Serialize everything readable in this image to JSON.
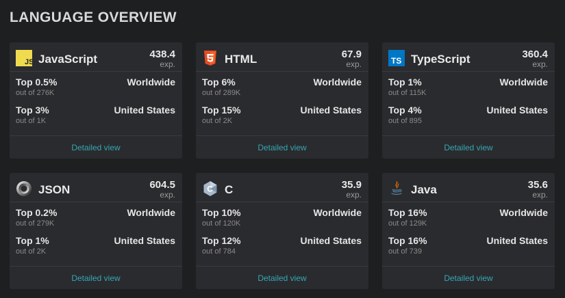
{
  "page": {
    "title": "LANGUAGE OVERVIEW"
  },
  "cards": [
    {
      "icon": "javascript-icon",
      "name": "JavaScript",
      "exp": "438.4",
      "exp_unit": "exp.",
      "worldwide": {
        "top": "Top 0.5%",
        "out_of": "out of 276K",
        "region": "Worldwide"
      },
      "us": {
        "top": "Top 3%",
        "out_of": "out of 1K",
        "region": "United States"
      },
      "link": "Detailed view"
    },
    {
      "icon": "html5-icon",
      "name": "HTML",
      "exp": "67.9",
      "exp_unit": "exp.",
      "worldwide": {
        "top": "Top 6%",
        "out_of": "out of 289K",
        "region": "Worldwide"
      },
      "us": {
        "top": "Top 15%",
        "out_of": "out of 2K",
        "region": "United States"
      },
      "link": "Detailed view"
    },
    {
      "icon": "typescript-icon",
      "name": "TypeScript",
      "exp": "360.4",
      "exp_unit": "exp.",
      "worldwide": {
        "top": "Top 1%",
        "out_of": "out of 115K",
        "region": "Worldwide"
      },
      "us": {
        "top": "Top 4%",
        "out_of": "out of 895",
        "region": "United States"
      },
      "link": "Detailed view"
    },
    {
      "icon": "json-icon",
      "name": "JSON",
      "exp": "604.5",
      "exp_unit": "exp.",
      "worldwide": {
        "top": "Top 0.2%",
        "out_of": "out of 279K",
        "region": "Worldwide"
      },
      "us": {
        "top": "Top 1%",
        "out_of": "out of 2K",
        "region": "United States"
      },
      "link": "Detailed view"
    },
    {
      "icon": "c-language-icon",
      "name": "C",
      "exp": "35.9",
      "exp_unit": "exp.",
      "worldwide": {
        "top": "Top 10%",
        "out_of": "out of 120K",
        "region": "Worldwide"
      },
      "us": {
        "top": "Top 12%",
        "out_of": "out of 784",
        "region": "United States"
      },
      "link": "Detailed view"
    },
    {
      "icon": "java-icon",
      "name": "Java",
      "exp": "35.6",
      "exp_unit": "exp.",
      "worldwide": {
        "top": "Top 16%",
        "out_of": "out of 129K",
        "region": "Worldwide"
      },
      "us": {
        "top": "Top 16%",
        "out_of": "out of 739",
        "region": "United States"
      },
      "link": "Detailed view"
    }
  ],
  "colors": {
    "background": "#1e1f21",
    "card": "#2a2b2e",
    "link": "#35a8b5",
    "javascript": "#f0db4f",
    "html": "#e44d26",
    "typescript": "#0076c6",
    "c": "#a8b9cc",
    "java": "#e76f00"
  }
}
